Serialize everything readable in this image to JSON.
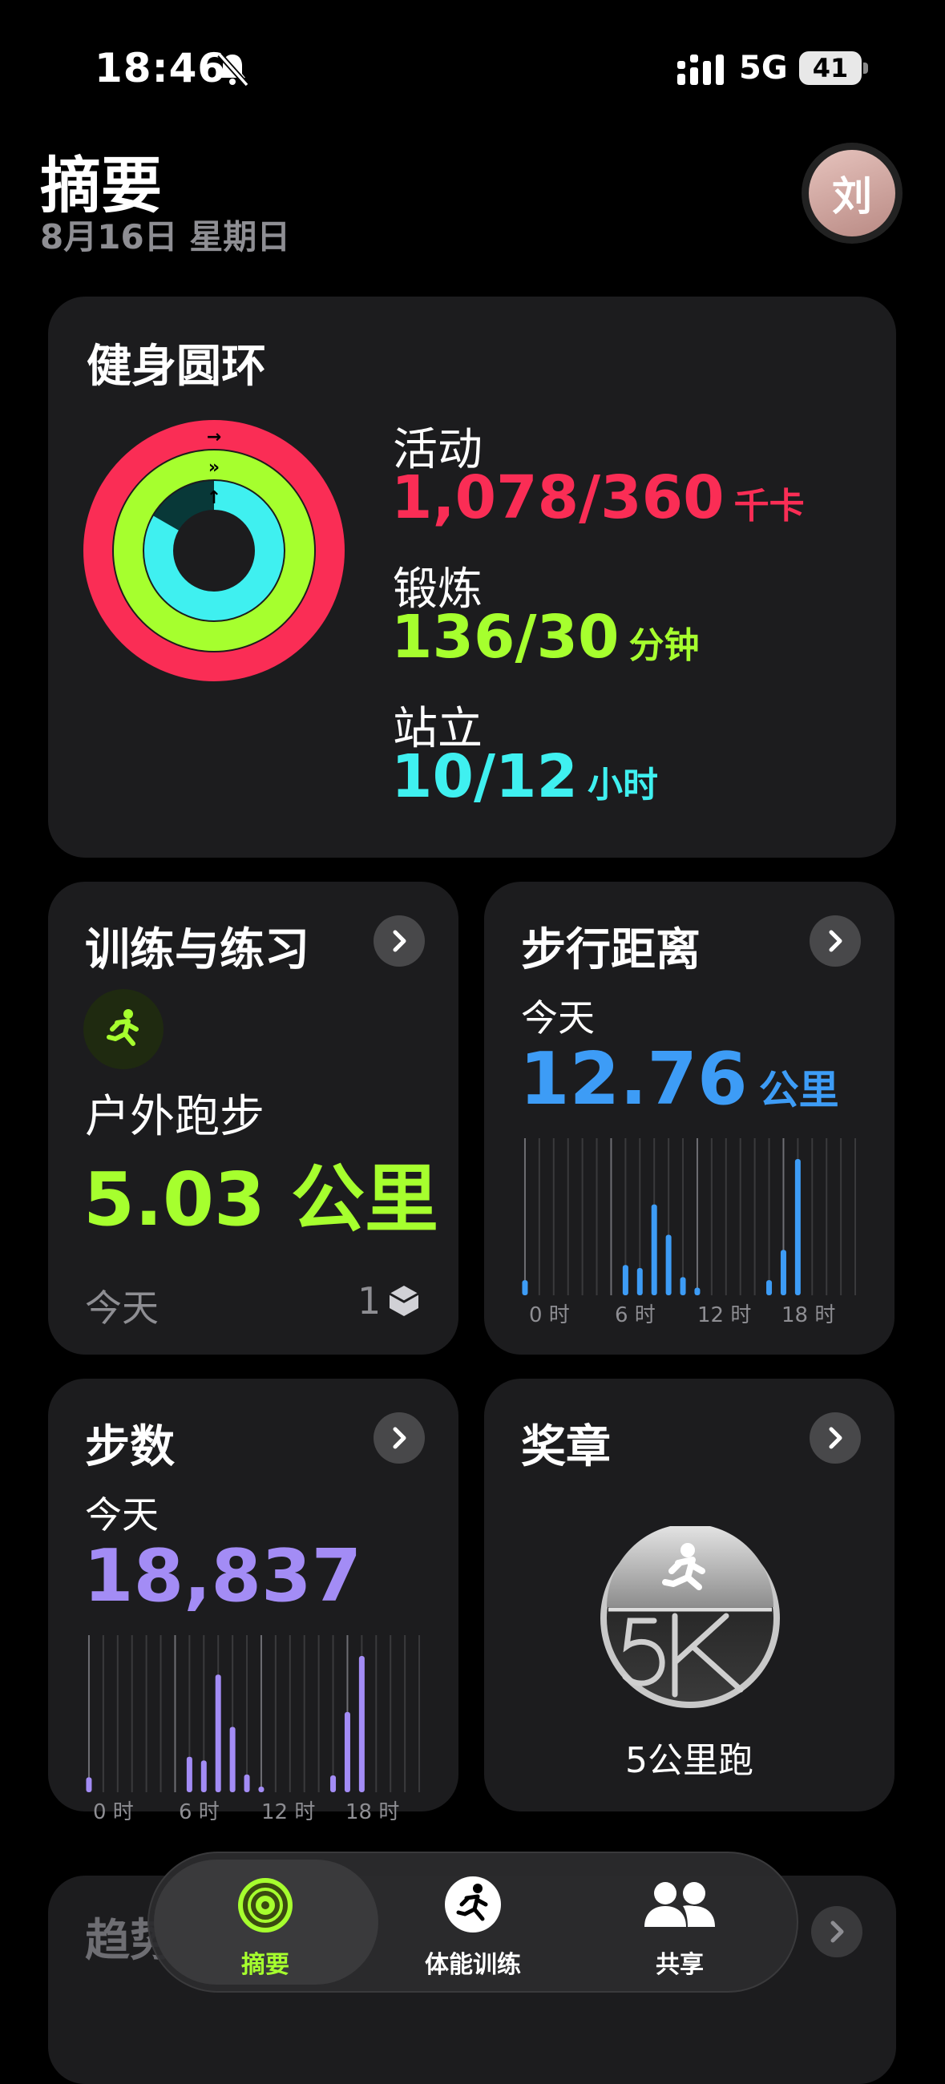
{
  "status": {
    "time": "18:46",
    "network": "5G",
    "battery": "41"
  },
  "header": {
    "title": "摘要",
    "date": "8月16日 星期日",
    "avatar": "刘"
  },
  "rings": {
    "title": "健身圆环",
    "move": {
      "label": "活动",
      "value": "1,078/360",
      "unit": "千卡",
      "color": "#fa2d55"
    },
    "exercise": {
      "label": "锻炼",
      "value": "136/30",
      "unit": "分钟",
      "color": "#a6ff2e"
    },
    "stand": {
      "label": "站立",
      "value": "10/12",
      "unit": "小时",
      "color": "#3ff0f0"
    }
  },
  "workouts": {
    "title": "训练与练习",
    "activity": "户外跑步",
    "distance": "5.03 公里",
    "period": "今天",
    "count": "1",
    "accent": "#a6ff2e"
  },
  "walking": {
    "title": "步行距离",
    "period": "今天",
    "value": "12.76",
    "unit": "公里",
    "color": "#3d9cf6",
    "axis": [
      "0 时",
      "6 时",
      "12 时",
      "18 时"
    ]
  },
  "steps": {
    "title": "步数",
    "period": "今天",
    "value": "18,837",
    "color": "#a38cf5",
    "axis": [
      "0 时",
      "6 时",
      "12 时",
      "18 时"
    ]
  },
  "awards": {
    "title": "奖章",
    "badge_label": "5公里跑"
  },
  "trends": {
    "title": "趋势"
  },
  "tabbar": {
    "items": [
      {
        "label": "摘要",
        "icon": "activity-rings-icon",
        "selected": true
      },
      {
        "label": "体能训练",
        "icon": "running-icon",
        "selected": false
      },
      {
        "label": "共享",
        "icon": "people-icon",
        "selected": false
      }
    ]
  },
  "chart_data": [
    {
      "type": "bar",
      "title": "步行距离",
      "x": [
        0,
        1,
        2,
        3,
        4,
        5,
        6,
        7,
        8,
        9,
        10,
        11,
        12,
        13,
        14,
        15,
        16,
        17,
        18,
        19,
        20,
        21,
        22,
        23
      ],
      "values": [
        0.1,
        0,
        0,
        0,
        0,
        0,
        0,
        0.2,
        0.18,
        0.6,
        0.4,
        0.12,
        0.05,
        0,
        0,
        0,
        0,
        0.1,
        0.3,
        0.9,
        0,
        0,
        0,
        0
      ],
      "xticks": [
        "0 时",
        "6 时",
        "12 时",
        "18 时"
      ]
    },
    {
      "type": "bar",
      "title": "步数",
      "x": [
        0,
        1,
        2,
        3,
        4,
        5,
        6,
        7,
        8,
        9,
        10,
        11,
        12,
        13,
        14,
        15,
        16,
        17,
        18,
        19,
        20,
        21,
        22,
        23
      ],
      "values": [
        80,
        0,
        0,
        0,
        0,
        0,
        0,
        190,
        170,
        630,
        350,
        95,
        30,
        0,
        0,
        0,
        0,
        90,
        430,
        730,
        0,
        0,
        0,
        0
      ],
      "xticks": [
        "0 时",
        "6 时",
        "12 时",
        "18 时"
      ]
    }
  ]
}
